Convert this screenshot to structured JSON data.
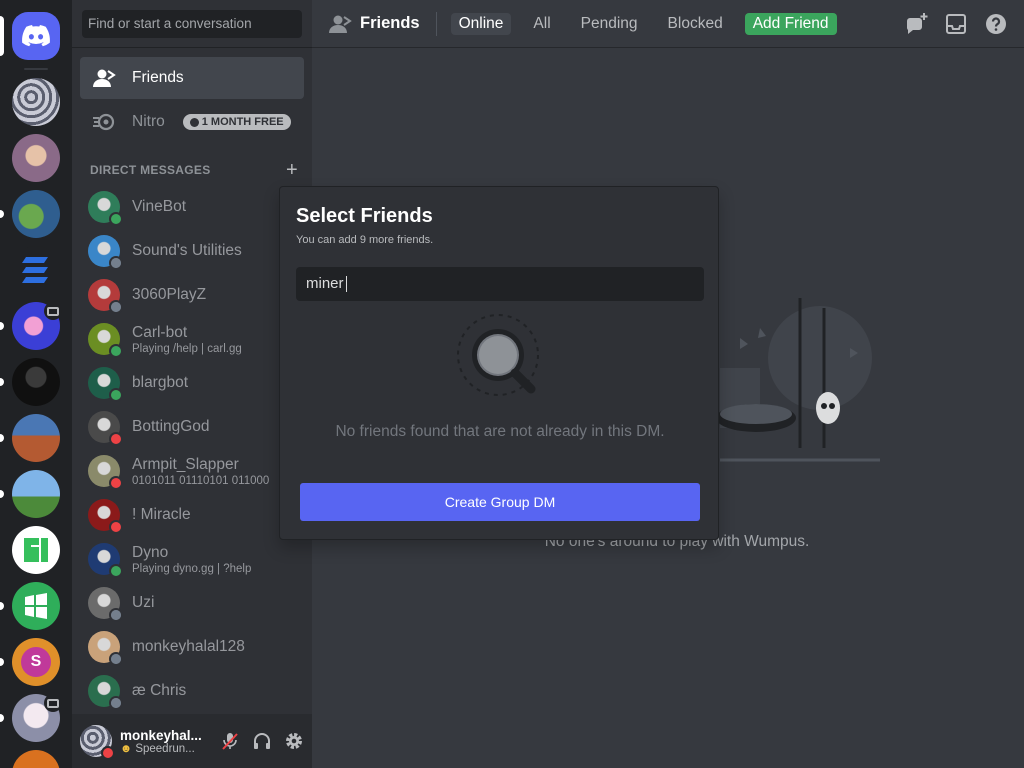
{
  "search": {
    "placeholder": "Find or start a conversation"
  },
  "nav": {
    "friends_label": "Friends",
    "nitro_label": "Nitro",
    "nitro_badge": "1 MONTH FREE"
  },
  "dm_header": {
    "label": "DIRECT MESSAGES",
    "add": "+"
  },
  "direct_messages": [
    {
      "name": "VineBot",
      "sub": "",
      "status": "online",
      "color": "#2f7d5a"
    },
    {
      "name": "Sound's Utilities",
      "sub": "",
      "status": "offline",
      "color": "#3a86c8"
    },
    {
      "name": "3060PlayZ",
      "sub": "",
      "status": "offline",
      "color": "#b43b3b"
    },
    {
      "name": "Carl-bot",
      "sub": "Playing /help | carl.gg",
      "status": "online",
      "color": "#6b8e23"
    },
    {
      "name": "blargbot",
      "sub": "",
      "status": "online",
      "color": "#1e5e4a"
    },
    {
      "name": "BottingGod",
      "sub": "",
      "status": "dnd",
      "color": "#4a4a4a"
    },
    {
      "name": "Armpit_Slapper",
      "sub": "0101011 01110101 011000",
      "status": "dnd",
      "color": "#8a8a6a"
    },
    {
      "name": "! Miracle",
      "sub": "",
      "status": "dnd",
      "color": "#8b1a1a"
    },
    {
      "name": "Dyno",
      "sub": "Playing dyno.gg | ?help",
      "status": "online",
      "color": "#1f3b73"
    },
    {
      "name": "Uzi",
      "sub": "",
      "status": "offline",
      "color": "#6b6b6b"
    },
    {
      "name": "monkeyhalal128",
      "sub": "",
      "status": "offline",
      "color": "#c9a27a"
    },
    {
      "name": "æ Chris",
      "sub": "",
      "status": "offline",
      "color": "#2a6e4e"
    }
  ],
  "user_panel": {
    "name": "monkeyhal...",
    "status": "Speedrun..."
  },
  "topbar": {
    "title": "Friends",
    "tabs": [
      "Online",
      "All",
      "Pending",
      "Blocked"
    ],
    "add_friend": "Add Friend"
  },
  "main": {
    "empty_text": "No one's around to play with Wumpus."
  },
  "popout": {
    "title": "Select Friends",
    "subtitle": "You can add 9 more friends.",
    "input_value": "miner",
    "empty_text": "No friends found that are not already in this DM.",
    "button": "Create Group DM"
  },
  "colors": {
    "blurple": "#5865f2",
    "green": "#3ba55d",
    "red": "#ed4245",
    "bg_main": "#36393f",
    "bg_sidebar": "#2f3136",
    "bg_rail": "#202225"
  },
  "servers": [
    {
      "name": "home",
      "color": "#5865f2"
    },
    {
      "name": "server-1",
      "color": "#9aa0b0"
    },
    {
      "name": "server-2",
      "color": "#b7a3c4"
    },
    {
      "name": "server-3",
      "color": "#4f8a3a"
    },
    {
      "name": "server-4",
      "color": "#1d3a8f"
    },
    {
      "name": "server-5",
      "color": "#c24ba0"
    },
    {
      "name": "server-6",
      "color": "#2b2b2b"
    },
    {
      "name": "server-7",
      "color": "#c0603a"
    },
    {
      "name": "server-8",
      "color": "#5f8fd6"
    },
    {
      "name": "server-9",
      "color": "#ffffff"
    },
    {
      "name": "server-10",
      "color": "#2fae5a"
    },
    {
      "name": "server-11",
      "color": "#e0902a"
    },
    {
      "name": "server-12",
      "color": "#d8d8e0"
    },
    {
      "name": "server-13",
      "color": "#d9711f"
    }
  ]
}
